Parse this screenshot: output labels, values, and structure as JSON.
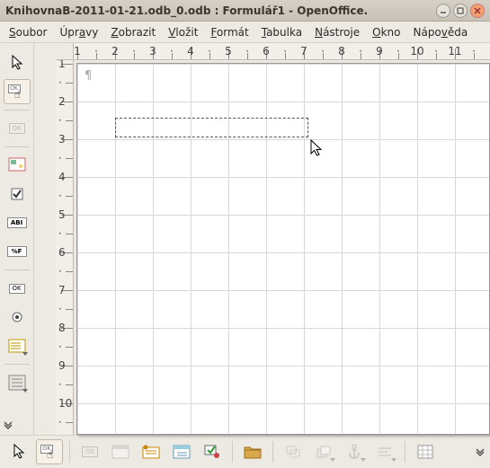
{
  "titlebar": {
    "title": "KnihovnaB-2011-01-21.odb_0.odb : Formulář1 - OpenOffice."
  },
  "menubar": {
    "soubor": "Soubor",
    "upravy": "Úpravy",
    "zobrazit": "Zobrazit",
    "vlozit": "Vložit",
    "format": "Formát",
    "tabulka": "Tabulka",
    "nastroje": "Nástroje",
    "okno": "Okno",
    "napoveda": "Nápověda"
  },
  "ruler": {
    "h": [
      "1",
      "2",
      "3",
      "4",
      "5",
      "6",
      "7",
      "8",
      "9",
      "10",
      "11"
    ],
    "v": [
      "1",
      "2",
      "3",
      "4",
      "5",
      "6",
      "7",
      "8",
      "9",
      "10"
    ]
  },
  "tools": {
    "select": "Select",
    "pushbutton": "Push Button",
    "ok_disabled": "OK",
    "checkbox_form": "Form Checkbox",
    "checkbox": "Check Box",
    "label": "Label Field",
    "formatted": "Formatted Field",
    "okbadge": "OK",
    "radio": "Option Button",
    "listbox": "List Box",
    "more": "More Controls"
  },
  "bottom": {
    "select": "Select",
    "designmode": "Design Mode",
    "t1": "Control",
    "t2": "Form",
    "t3": "Form Navigator",
    "t4": "Add Field",
    "t5": "Activation Order",
    "folder": "Open in Design Mode",
    "t6": "Position and Size",
    "t7": "Bring to Front",
    "t8": "Anchor",
    "t9": "Alignment",
    "grid": "Grid"
  }
}
